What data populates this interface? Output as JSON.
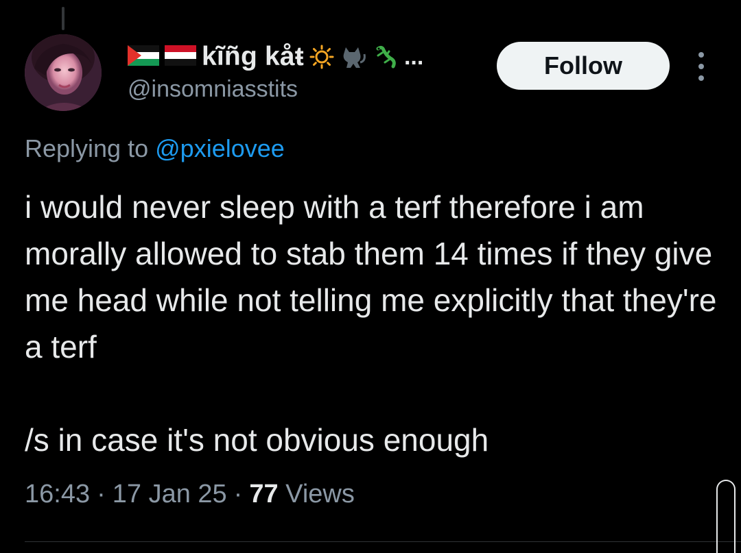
{
  "author": {
    "display_name": "kĩñg kåŧ",
    "handle": "@insomniasstits",
    "name_emojis": [
      "sun-icon",
      "black-cat-icon",
      "lizard-icon"
    ],
    "name_truncation": "..."
  },
  "actions": {
    "follow_label": "Follow",
    "more_icon": "more-vertical-icon"
  },
  "reply_context": {
    "prefix": "Replying to",
    "mention": "@pxielovee"
  },
  "tweet": {
    "paragraph1": "i would never sleep with a terf therefore i am morally allowed to stab them 14 times if they give me head while not telling me explicitly that they're a terf",
    "paragraph2": "/s in case it's not obvious enough"
  },
  "meta": {
    "time": "16:43",
    "separator": "·",
    "date": "17 Jan 25",
    "views_count": "77",
    "views_label": "Views"
  },
  "colors": {
    "background": "#000000",
    "text_primary": "#e7e9ea",
    "text_secondary": "#8b98a5",
    "link": "#1d9bf0",
    "follow_bg": "#eff3f4"
  }
}
